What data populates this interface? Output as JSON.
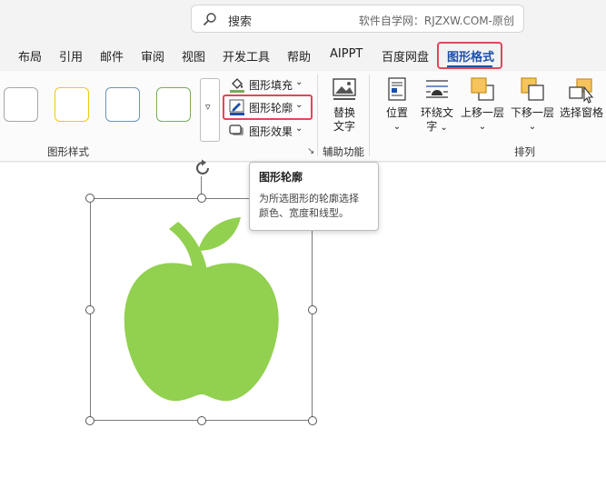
{
  "search": {
    "label": "搜索",
    "watermark": "软件自学网：RJZXW.COM-原创"
  },
  "tabs": [
    {
      "label": "布局"
    },
    {
      "label": "引用"
    },
    {
      "label": "邮件"
    },
    {
      "label": "审阅"
    },
    {
      "label": "视图"
    },
    {
      "label": "开发工具"
    },
    {
      "label": "帮助"
    },
    {
      "label": "AIPPT"
    },
    {
      "label": "百度网盘"
    },
    {
      "label": "图形格式",
      "active": true
    }
  ],
  "ribbon": {
    "shape_styles": {
      "group_label": "图形样式",
      "swatch_colors": [
        "#a6a6a6",
        "#f2c811",
        "#6e93b8",
        "#77ad5b"
      ],
      "more_label": "▿",
      "fill_label": "图形填充",
      "outline_label": "图形轮廓",
      "effects_label": "图形效果",
      "launcher": "↘"
    },
    "accessibility": {
      "group_label": "辅助功能",
      "alt_text_line1": "替换",
      "alt_text_line2": "文字"
    },
    "arrange": {
      "group_label": "排列",
      "position_label": "位置",
      "wrap_line1": "环绕文",
      "wrap_line2": "字",
      "bring_forward_label": "上移一层",
      "send_backward_label": "下移一层",
      "selection_pane_label": "选择窗格"
    }
  },
  "tooltip": {
    "title": "图形轮廓",
    "line1": "为所选图形的轮廓选择",
    "line2": "颜色、宽度和线型。"
  },
  "colors": {
    "apple_green": "#92d050",
    "accent_blue": "#1c4fa8",
    "highlight_red": "#e0475a"
  }
}
